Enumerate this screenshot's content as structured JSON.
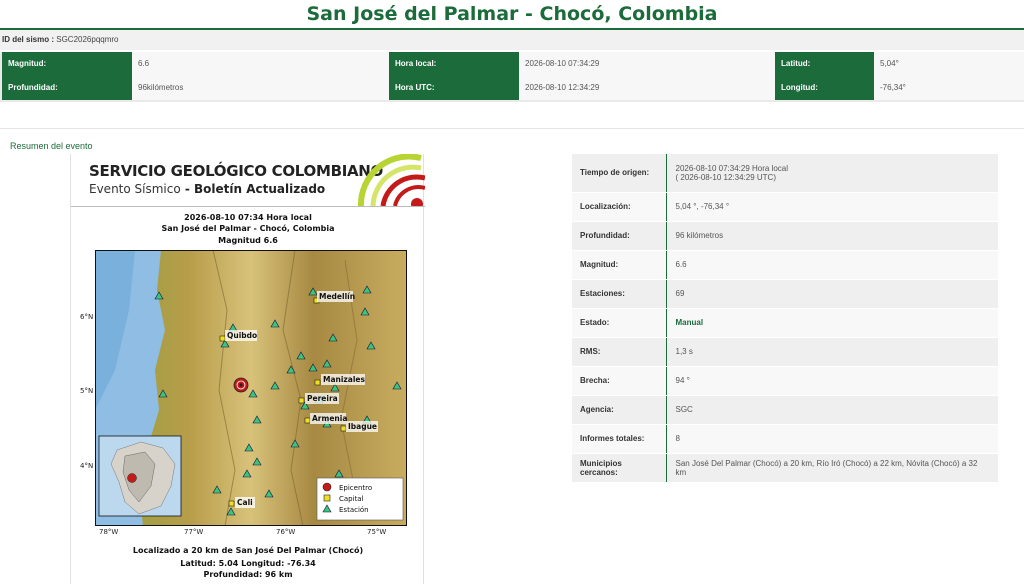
{
  "page": {
    "title": "San José del Palmar - Chocó, Colombia"
  },
  "id_row": {
    "label": "ID del sismo :",
    "value": "SGC2026pqqmro"
  },
  "summary": {
    "magnitude_label": "Magnitud:",
    "magnitude": "6.6",
    "depth_label": "Profundidad:",
    "depth": "96kilómetros",
    "local_time_label": "Hora local:",
    "local_time": "2026-08-10 07:34:29",
    "utc_time_label": "Hora UTC:",
    "utc_time": "2026-08-10 12:34:29",
    "lat_label": "Latitud:",
    "lat": "5,04°",
    "lon_label": "Longitud:",
    "lon": "-76,34°"
  },
  "panel_title": "Resumen del evento",
  "bulletin": {
    "org": "SERVICIO GEOLÓGICO COLOMBIANO",
    "subtitle_a": "Evento Sísmico",
    "subtitle_b": " - Boletín Actualizado",
    "date_line": "2026-08-10 07:34 Hora local",
    "place_line": "San José del Palmar - Chocó, Colombia",
    "mag_line": "Magnitud 6.6",
    "located_line": "Localizado a 20 km de San José Del Palmar (Chocó)",
    "latlon_line": "Latitud: 5.04 Longitud: -76.34",
    "depth_line": "Profundidad: 96 km",
    "legend_epicentro": "Epicentro",
    "legend_capital": "Capital",
    "legend_estacion": "Estación",
    "cities": [
      "Medellín",
      "Quibdo",
      "Manizales",
      "Pereira",
      "Armenia",
      "Ibague",
      "Cali"
    ],
    "lat_ticks": [
      "6°N",
      "5°N",
      "4°N"
    ],
    "lon_ticks": [
      "78°W",
      "77°W",
      "76°W",
      "75°W"
    ],
    "colors": {
      "epicenter": "#c41a1a",
      "station": "#3cc47a",
      "capital": "#f0e020"
    }
  },
  "details": [
    {
      "label": "Tiempo de origen:",
      "value": "2026-08-10 07:34:29 Hora local",
      "value2": "( 2026-08-10 12:34:29 UTC)"
    },
    {
      "label": "Localización:",
      "value": "5,04 °, -76,34 °"
    },
    {
      "label": "Profundidad:",
      "value": "96 kilómetros"
    },
    {
      "label": "Magnitud:",
      "value": "6.6"
    },
    {
      "label": "Estaciones:",
      "value": "69"
    },
    {
      "label": "Estado:",
      "value": "Manual"
    },
    {
      "label": "RMS:",
      "value": "1,3 s"
    },
    {
      "label": "Brecha:",
      "value": "94 °"
    },
    {
      "label": "Agencia:",
      "value": "SGC"
    },
    {
      "label": "Informes totales:",
      "value": "8"
    },
    {
      "label": "Municipios cercanos:",
      "value": "San José Del Palmar (Chocó) a 20 km, Río Iró (Chocó) a 22 km, Nóvita (Chocó) a 32 km"
    }
  ]
}
